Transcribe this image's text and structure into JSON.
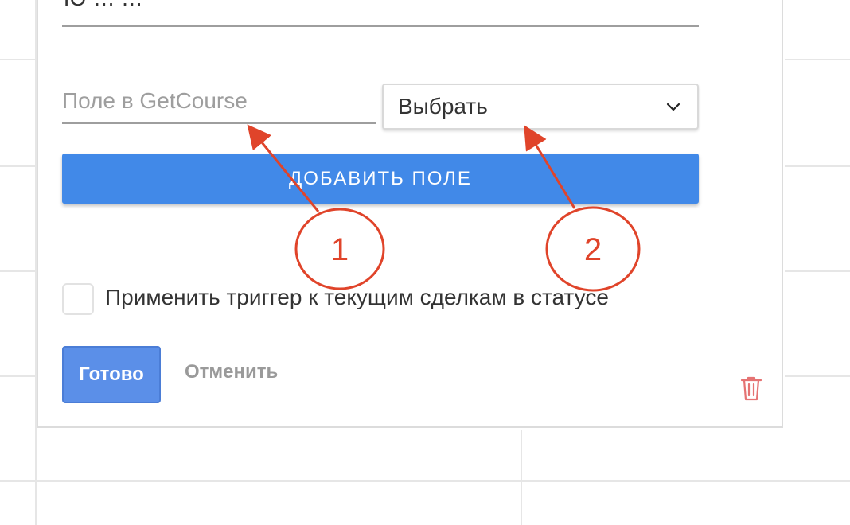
{
  "form": {
    "top_field_partial_text": "Ю ... ...",
    "field_placeholder": "Поле в GetCourse",
    "select_value": "Выбрать",
    "add_field_label": "ДОБАВИТЬ ПОЛЕ",
    "apply_trigger_label": "Применить триггер к текущим сделкам в статусе",
    "done_label": "Готово",
    "cancel_label": "Отменить"
  },
  "annotations": {
    "marker_1": "1",
    "marker_2": "2"
  },
  "colors": {
    "primary_blue": "#4189e8",
    "done_blue": "#5b8fe8",
    "annotation_red": "#e0442a",
    "trash_red": "#e57373"
  },
  "icons": {
    "select_arrow": "chevron-down-icon",
    "delete": "trash-icon"
  }
}
